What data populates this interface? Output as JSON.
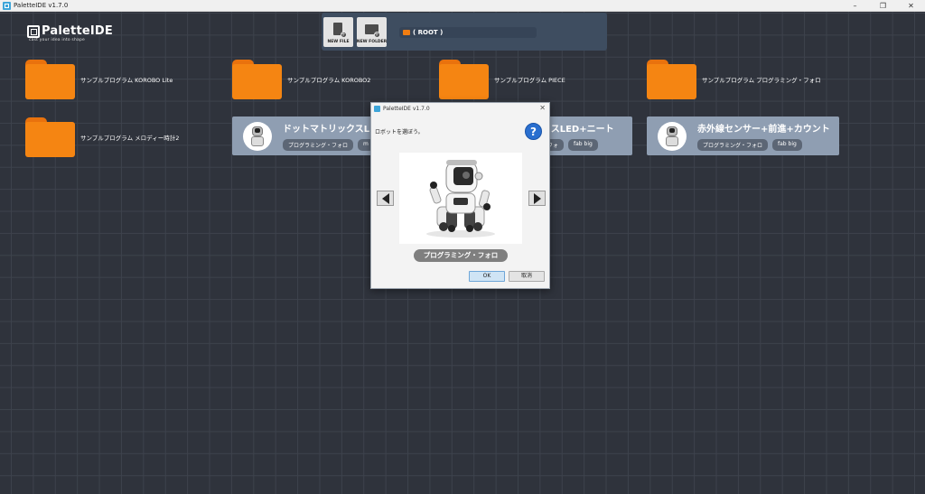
{
  "window": {
    "title": "PaletteIDE v1.7.0"
  },
  "logo": {
    "name": "PaletteIDE",
    "tagline": "cast your idea into shape"
  },
  "toolbar": {
    "new_file_label": "NEW FILE",
    "new_folder_label": "NEW FOLDER",
    "path": "( ROOT )"
  },
  "folders": [
    {
      "label": "サンプルプログラム KOROBO Lite"
    },
    {
      "label": "サンプルプログラム KOROBO2"
    },
    {
      "label": "サンプルプログラム PIECE"
    },
    {
      "label": "サンプルプログラム プログラミング・フォロ"
    },
    {
      "label": "サンプルプログラム メロディー時計2"
    }
  ],
  "cards": [
    {
      "title": "ドットマトリックスLED",
      "tags": [
        "プログラミング・フォロ",
        "m"
      ]
    },
    {
      "title": "クスLED+ニート",
      "tags": [
        "フォ",
        "fab big"
      ]
    },
    {
      "title": "赤外線センサー+前進+カウント",
      "tags": [
        "プログラミング・フォロ",
        "fab big"
      ]
    }
  ],
  "dialog": {
    "title": "PaletteIDE v1.7.0",
    "prompt": "ロボットを選ぼう。",
    "robot_name": "プログラミング・フォロ",
    "ok_label": "OK",
    "cancel_label": "取消"
  },
  "icons": {
    "app": "palette-app-icon",
    "folder": "folder-icon",
    "question": "question-icon"
  },
  "colors": {
    "background": "#2f333c",
    "folder": "#f58512",
    "card": "#8f9eb2",
    "toolbar": "#3e4d60"
  }
}
